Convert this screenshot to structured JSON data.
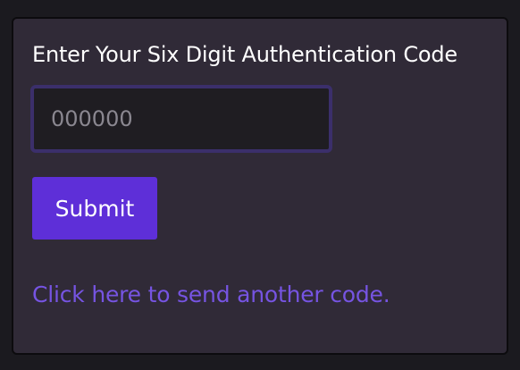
{
  "form": {
    "title": "Enter Your Six Digit Authentication Code",
    "code_input": {
      "value": "",
      "placeholder": "000000"
    },
    "submit_label": "Submit",
    "resend_link_text": "Click here to send another code."
  },
  "colors": {
    "page_background": "#1b1a1f",
    "card_background": "#302a37",
    "input_background": "#1f1d22",
    "input_border": "#3b2f6b",
    "accent": "#5e2fd8",
    "link": "#7654e2",
    "text": "#ffffff",
    "placeholder": "#8a8790"
  }
}
